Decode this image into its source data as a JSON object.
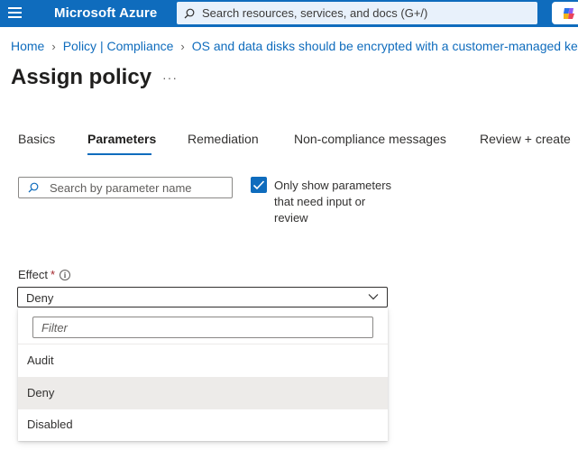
{
  "topbar": {
    "brand": "Microsoft Azure",
    "search_placeholder": "Search resources, services, and docs (G+/)",
    "background": "#0f6cbd"
  },
  "breadcrumb": [
    {
      "label": "Home"
    },
    {
      "label": "Policy | Compliance"
    },
    {
      "label": "OS and data disks should be encrypted with a customer-managed key"
    }
  ],
  "page": {
    "title": "Assign policy",
    "more_label": "···"
  },
  "tabs": [
    {
      "label": "Basics",
      "active": false
    },
    {
      "label": "Parameters",
      "active": true
    },
    {
      "label": "Remediation",
      "active": false
    },
    {
      "label": "Non-compliance messages",
      "active": false
    },
    {
      "label": "Review + create",
      "active": false
    }
  ],
  "parameters": {
    "search_placeholder": "Search by parameter name",
    "only_show_label": "Only show parameters that need input or review",
    "only_show_checked": true
  },
  "effect": {
    "label": "Effect",
    "required_mark": "*",
    "info_glyph": "i",
    "selected_value": "Deny",
    "filter_placeholder": "Filter",
    "options": [
      {
        "label": "Audit",
        "selected": false
      },
      {
        "label": "Deny",
        "selected": true
      },
      {
        "label": "Disabled",
        "selected": false
      }
    ]
  },
  "icons": {
    "menu": "hamburger-menu-icon",
    "search": "search-icon",
    "copilot": "copilot-icon",
    "chevron": "chevron-down-icon",
    "check": "checkmark-icon",
    "info": "info-icon"
  }
}
